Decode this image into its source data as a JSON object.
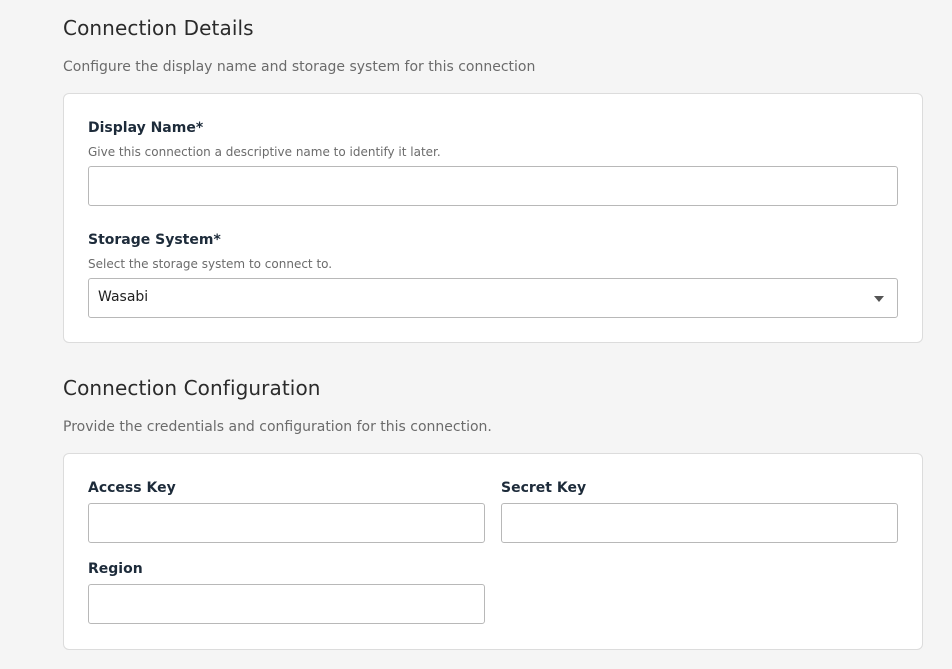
{
  "connection_details": {
    "title": "Connection Details",
    "description": "Configure the display name and storage system for this connection",
    "display_name": {
      "label": "Display Name*",
      "hint": "Give this connection a descriptive name to identify it later.",
      "value": ""
    },
    "storage_system": {
      "label": "Storage System*",
      "hint": "Select the storage system to connect to.",
      "selected": "Wasabi",
      "icon": "chevron-down-icon"
    }
  },
  "connection_configuration": {
    "title": "Connection Configuration",
    "description": "Provide the credentials and configuration for this connection.",
    "access_key": {
      "label": "Access Key",
      "value": ""
    },
    "secret_key": {
      "label": "Secret Key",
      "value": ""
    },
    "region": {
      "label": "Region",
      "value": ""
    }
  }
}
